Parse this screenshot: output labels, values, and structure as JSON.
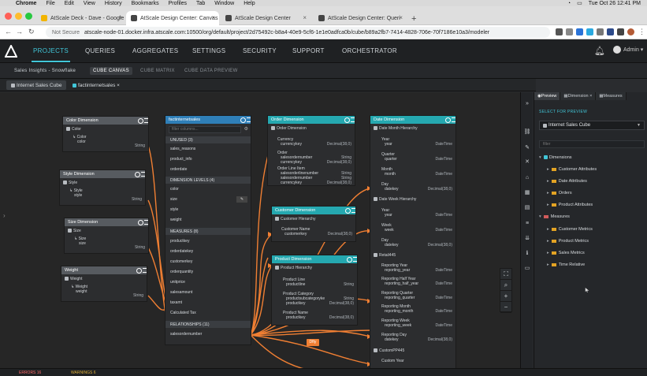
{
  "mac_menubar": {
    "apple": "",
    "items": [
      "Chrome",
      "File",
      "Edit",
      "View",
      "History",
      "Bookmarks",
      "Profiles",
      "Tab",
      "Window",
      "Help"
    ],
    "datetime": "Tue Oct 26  12:41 PM"
  },
  "browser": {
    "tabs": [
      {
        "label": "AtScale Deck - Dave - Google",
        "active": false
      },
      {
        "label": "AtScale Design Center: Canvas",
        "active": true
      },
      {
        "label": "AtScale Design Center",
        "active": false
      },
      {
        "label": "AtScale Design Center: Queri",
        "active": false
      }
    ],
    "new_tab": "+",
    "url_prefix": "Not Secure",
    "url": "atscale-node-01.docker.infra.atscale.com:10500/org/default/project/2d75492c-b8a4-40e9-5cf6-1e1e0adfca0b/cube/b89a2fb7-7414-4828-706e-70f7186e10a3/modeler"
  },
  "app_nav": {
    "items": [
      "PROJECTS",
      "QUERIES",
      "AGGREGATES",
      "SETTINGS",
      "SECURITY",
      "SUPPORT",
      "ORCHESTRATOR"
    ],
    "active": "PROJECTS",
    "admin": "Admin ▾"
  },
  "sub_nav": {
    "items": [
      "Sales Insights - Snowflake",
      "CUBE CANVAS",
      "CUBE MATRIX",
      "CUBE DATA PREVIEW"
    ],
    "active": "CUBE CANVAS"
  },
  "doc_tabs": [
    {
      "label": "Internet Sales Cube",
      "active": true
    },
    {
      "label": "factinternetsales ×",
      "active": false
    }
  ],
  "canvas": {
    "color_dim": {
      "title": "Color Dimension",
      "hier": "Color",
      "level": "Color",
      "level2": "color",
      "type": "String"
    },
    "style_dim": {
      "title": "Style Dimension",
      "hier": "Style",
      "level": "Style",
      "level2": "style",
      "type": "String"
    },
    "size_dim": {
      "title": "Size Dimension",
      "hier": "Size",
      "level": "Size",
      "level2": "size",
      "type": "String"
    },
    "weight_dim": {
      "title": "Weight",
      "hier": "Weight",
      "level": "Weight",
      "level2": "weight",
      "type": "String"
    },
    "fact": {
      "title": "factinternetsales",
      "search_placeholder": "filter columns...",
      "unused_header": "UNUSED (3)",
      "unused": [
        "sales_reasons",
        "product_info",
        "orderdate"
      ],
      "dim_levels_header": "DIMENSION LEVELS (4)",
      "dim_levels": [
        "color",
        "size",
        "style",
        "weight"
      ],
      "measures_header": "MEASURES (8)",
      "measures": [
        "productkey",
        "orderdatekey",
        "customerkey",
        "orderquantity",
        "unitprice",
        "salesamount",
        "taxamt",
        "Calculated Tax"
      ],
      "relationships_header": "RELATIONSHIPS (11)",
      "relationships": [
        "salesordernumber"
      ]
    },
    "order_dim": {
      "title": "Order Dimension",
      "hier": "Order Dimension",
      "rows": [
        {
          "a": "Currency",
          "b": "currencykey",
          "t": "Decimal(38,0)"
        },
        {
          "a": "Order",
          "b": "salesordernumber",
          "t": "String"
        },
        {
          "a": "",
          "b": "currencykey",
          "t": "Decimal(38,0)"
        },
        {
          "a": "Order Line Item",
          "b": "salesorderlinenumber",
          "t": "String"
        },
        {
          "a": "",
          "b": "salesordernumber",
          "t": "String"
        },
        {
          "a": "",
          "b": "currencykey",
          "t": "Decimal(38,0)"
        }
      ]
    },
    "customer_dim": {
      "title": "Customer Dimension",
      "hier": "Customer Hierarchy",
      "rows": [
        {
          "a": "Customer Name",
          "b": "customerkey",
          "t": "Decimal(38,0)"
        }
      ]
    },
    "product_dim": {
      "title": "Product Dimension",
      "hier": "Product Hierarchy",
      "rows": [
        {
          "a": "Product Line",
          "b": "productline",
          "t": "String"
        },
        {
          "a": "Product Category",
          "b": "productsubcategoryke",
          "t": "String"
        },
        {
          "a": "",
          "b": "productkey",
          "t": "Decimal(38,0)"
        },
        {
          "a": "Product Name",
          "b": "productkey",
          "t": "Decimal(38,0)"
        }
      ]
    },
    "date_dim": {
      "title": "Date Dimension",
      "sections": [
        {
          "hier": "Date Month Hierarchy",
          "rows": [
            {
              "a": "Year",
              "b": "year",
              "t": "DateTime"
            },
            {
              "a": "Quarter",
              "b": "quarter",
              "t": "DateTime"
            },
            {
              "a": "Month",
              "b": "month",
              "t": "DateTime"
            },
            {
              "a": "Day",
              "b": "datekey",
              "t": "Decimal(38,0)"
            }
          ]
        },
        {
          "hier": "Date Week Hierarchy",
          "rows": [
            {
              "a": "Year",
              "b": "year",
              "t": "DateTime"
            },
            {
              "a": "Week",
              "b": "week",
              "t": "DateTime"
            },
            {
              "a": "Day",
              "b": "datekey",
              "t": "Decimal(38,0)"
            }
          ]
        },
        {
          "hier": "Retail445",
          "rows": [
            {
              "a": "Reporting Year",
              "b": "reporting_year",
              "t": "DateTime"
            },
            {
              "a": "Reporting Half Year",
              "b": "reporting_half_year",
              "t": "DateTime"
            },
            {
              "a": "Reporting Quarter",
              "b": "reporting_quarter",
              "t": "DateTime"
            },
            {
              "a": "Reporting Month",
              "b": "reporting_month",
              "t": "DateTime"
            },
            {
              "a": "Reporting Week",
              "b": "reporting_week",
              "t": "DateTime"
            },
            {
              "a": "Reporting Day",
              "b": "datekey",
              "t": "Decimal(38,0)"
            }
          ]
        },
        {
          "hier": "CustomPP445",
          "rows": [
            {
              "a": "Custom Year",
              "b": "",
              "t": ""
            }
          ]
        }
      ]
    },
    "rel_label": "Dfty"
  },
  "right_panel": {
    "tabs": [
      "Preview",
      "Dimension ×",
      "Measures"
    ],
    "select_label": "SELECT FOR PREVIEW",
    "select_value": "Internet Sales Cube",
    "search_placeholder": "filter",
    "tree": [
      {
        "label": "Dimensions",
        "level": 0,
        "kind": "dim"
      },
      {
        "label": "Customer Attributes",
        "level": 1,
        "kind": "folder"
      },
      {
        "label": "Date Attributes",
        "level": 1,
        "kind": "folder"
      },
      {
        "label": "Orders",
        "level": 1,
        "kind": "folder"
      },
      {
        "label": "Product Attributes",
        "level": 1,
        "kind": "folder"
      },
      {
        "label": "Measures",
        "level": 0,
        "kind": "meas"
      },
      {
        "label": "Customer Metrics",
        "level": 1,
        "kind": "folder"
      },
      {
        "label": "Product Metrics",
        "level": 1,
        "kind": "folder"
      },
      {
        "label": "Sales Metrics",
        "level": 1,
        "kind": "folder"
      },
      {
        "label": "Time Relative",
        "level": 1,
        "kind": "folder"
      }
    ]
  },
  "bottom": {
    "errors": "ERRORS 16",
    "warnings": "WARNINGS 6"
  },
  "colors": {
    "accent": "#41c6d8",
    "orange": "#f07f33"
  }
}
